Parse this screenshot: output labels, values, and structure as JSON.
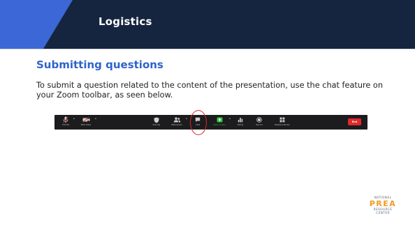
{
  "slide": {
    "title": "Logistics",
    "subtitle": "Submitting questions",
    "body": "To submit a question related to the content of the presentation, use the chat feature on your Zoom toolbar, as seen below."
  },
  "toolbar": {
    "items": [
      {
        "label": "Unmute",
        "icon": "microphone-icon"
      },
      {
        "label": "Start Video",
        "icon": "video-camera-icon"
      },
      {
        "label": "Security",
        "icon": "shield-icon"
      },
      {
        "label": "Participants",
        "icon": "people-icon"
      },
      {
        "label": "Chat",
        "icon": "chat-bubble-icon"
      },
      {
        "label": "Share Screen",
        "icon": "share-screen-icon"
      },
      {
        "label": "Polling",
        "icon": "bar-chart-icon"
      },
      {
        "label": "Record",
        "icon": "record-icon"
      },
      {
        "label": "Breakout Rooms",
        "icon": "breakout-rooms-icon"
      }
    ],
    "end_label": "End"
  },
  "logo": {
    "line1": "NATIONAL",
    "line2": "PREA",
    "line3": "RESOURCE",
    "line4": "CENTER"
  },
  "colors": {
    "header_bg": "#16253f",
    "header_accent": "#3c67d6",
    "subtitle": "#2f63c9",
    "toolbar_bg": "#1c1c1e",
    "share_green": "#35c246",
    "end_red": "#e0292b",
    "highlight_red": "#d62828",
    "logo_orange": "#f39a1f"
  }
}
